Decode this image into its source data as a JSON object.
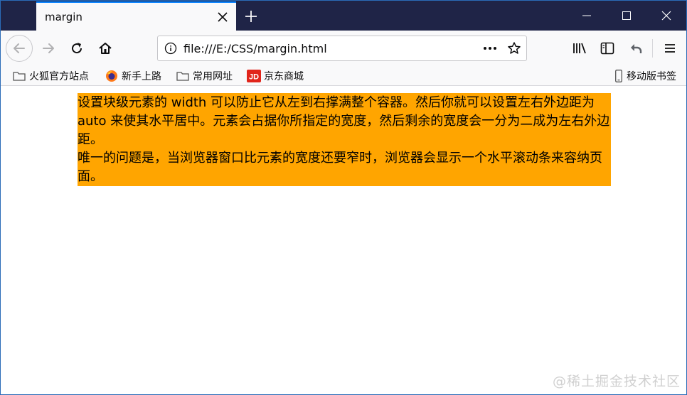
{
  "tab": {
    "title": "margin"
  },
  "urlbar": {
    "url": "file:///E:/CSS/margin.html"
  },
  "bookmarks": [
    {
      "label": "火狐官方站点",
      "icon": "folder-icon"
    },
    {
      "label": "新手上路",
      "icon": "firefox-icon"
    },
    {
      "label": "常用网址",
      "icon": "folder-icon"
    },
    {
      "label": "京东商城",
      "icon": "jd-icon"
    }
  ],
  "mobile_bookmarks": {
    "label": "移动版书签",
    "icon": "mobile-icon"
  },
  "content": {
    "paragraph1": "设置块级元素的 width 可以防止它从左到右撑满整个容器。然后你就可以设置左右外边距为 auto 来使其水平居中。元素会占据你所指定的宽度，然后剩余的宽度会一分为二成为左右外边距。",
    "paragraph2": "唯一的问题是，当浏览器窗口比元素的宽度还要窄时，浏览器会显示一个水平滚动条来容纳页面。",
    "box_color": "#ffa500"
  },
  "watermark": "@稀土掘金技术社区"
}
